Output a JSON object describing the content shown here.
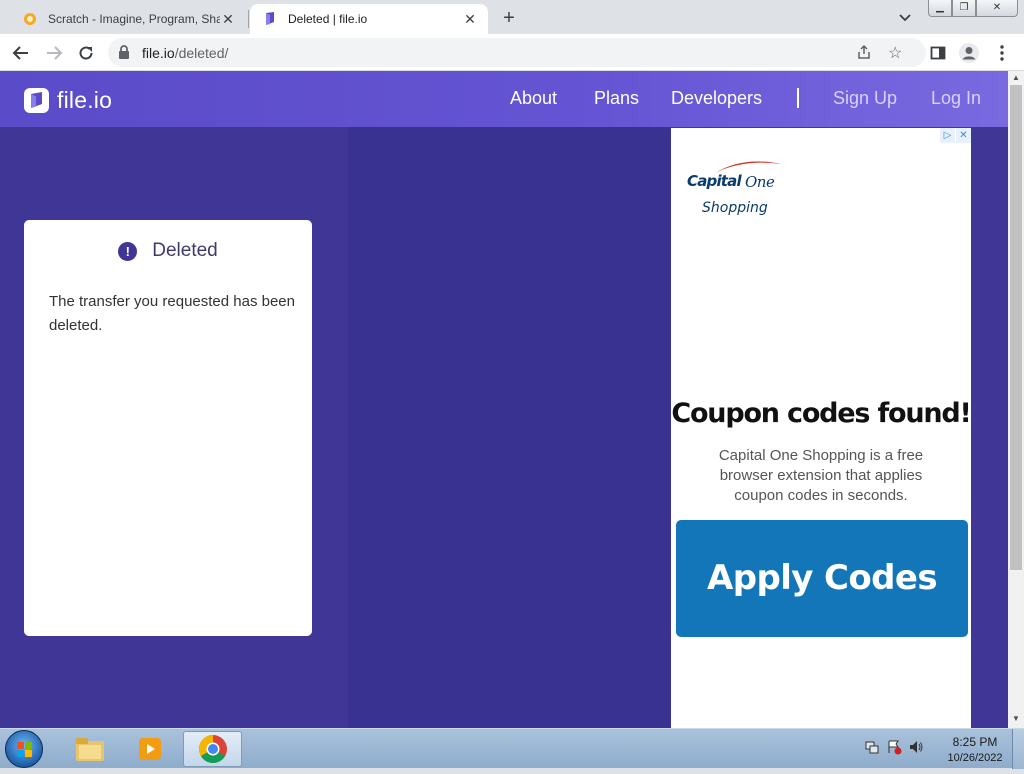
{
  "browser": {
    "tabs": [
      {
        "title": "Scratch - Imagine, Program, Shar",
        "active": false
      },
      {
        "title": "Deleted | file.io",
        "active": true
      }
    ],
    "url_host": "file.io",
    "url_path": "/deleted/"
  },
  "site": {
    "logo_text": "file.io",
    "nav": {
      "about": "About",
      "plans": "Plans",
      "developers": "Developers",
      "signup": "Sign Up",
      "login": "Log In"
    },
    "accent_color": "#3f3695"
  },
  "card": {
    "icon": "exclamation-icon",
    "title": "Deleted",
    "message": "The transfer you requested has been deleted."
  },
  "ad": {
    "brand_line1": "Capital",
    "brand_line2": "One",
    "brand_sub": "Shopping",
    "headline": "Coupon codes found!",
    "body": "Capital One Shopping is a free browser extension that applies coupon codes in seconds.",
    "cta": "Apply Codes",
    "cta_color": "#1276b9"
  },
  "taskbar": {
    "time": "8:25 PM",
    "date": "10/26/2022"
  }
}
